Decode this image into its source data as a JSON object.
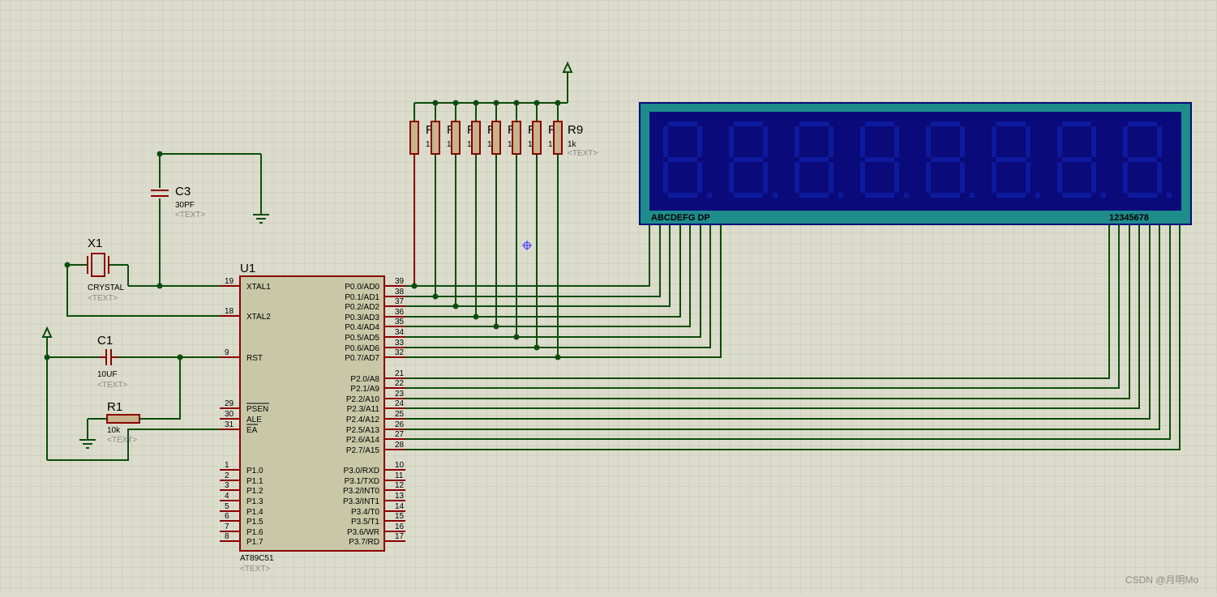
{
  "colors": {
    "background": "#dcdccc",
    "grid": "#c6c6b4",
    "wire": "#0b4d0b",
    "component": "#8b0000",
    "chip_body": "#c8c8a8",
    "display_frame": "#1f8c8c",
    "display_screen": "#0a0a7a",
    "segment_off": "#0d1a9e"
  },
  "mcu": {
    "ref": "U1",
    "part": "AT89C51",
    "text": "<TEXT>",
    "left_pins": [
      {
        "num": "19",
        "name": "XTAL1"
      },
      {
        "num": "18",
        "name": "XTAL2"
      },
      {
        "num": "9",
        "name": "RST"
      },
      {
        "num": "29",
        "name": "PSEN"
      },
      {
        "num": "30",
        "name": "ALE"
      },
      {
        "num": "31",
        "name": "EA"
      },
      {
        "num": "1",
        "name": "P1.0"
      },
      {
        "num": "2",
        "name": "P1.1"
      },
      {
        "num": "3",
        "name": "P1.2"
      },
      {
        "num": "4",
        "name": "P1.3"
      },
      {
        "num": "5",
        "name": "P1.4"
      },
      {
        "num": "6",
        "name": "P1.5"
      },
      {
        "num": "7",
        "name": "P1.6"
      },
      {
        "num": "8",
        "name": "P1.7"
      }
    ],
    "right_pins": [
      {
        "num": "39",
        "name": "P0.0/AD0"
      },
      {
        "num": "38",
        "name": "P0.1/AD1"
      },
      {
        "num": "37",
        "name": "P0.2/AD2"
      },
      {
        "num": "36",
        "name": "P0.3/AD3"
      },
      {
        "num": "35",
        "name": "P0.4/AD4"
      },
      {
        "num": "34",
        "name": "P0.5/AD5"
      },
      {
        "num": "33",
        "name": "P0.6/AD6"
      },
      {
        "num": "32",
        "name": "P0.7/AD7"
      },
      {
        "num": "21",
        "name": "P2.0/A8"
      },
      {
        "num": "22",
        "name": "P2.1/A9"
      },
      {
        "num": "23",
        "name": "P2.2/A10"
      },
      {
        "num": "24",
        "name": "P2.3/A11"
      },
      {
        "num": "25",
        "name": "P2.4/A12"
      },
      {
        "num": "26",
        "name": "P2.5/A13"
      },
      {
        "num": "27",
        "name": "P2.6/A14"
      },
      {
        "num": "28",
        "name": "P2.7/A15"
      },
      {
        "num": "10",
        "name": "P3.0/RXD"
      },
      {
        "num": "11",
        "name": "P3.1/TXD"
      },
      {
        "num": "12",
        "name": "P3.2/INT0"
      },
      {
        "num": "13",
        "name": "P3.3/INT1"
      },
      {
        "num": "14",
        "name": "P3.4/T0"
      },
      {
        "num": "15",
        "name": "P3.5/T1"
      },
      {
        "num": "16",
        "name": "P3.6/WR"
      },
      {
        "num": "17",
        "name": "P3.7/RD"
      }
    ]
  },
  "x1": {
    "ref": "X1",
    "value": "CRYSTAL",
    "text": "<TEXT>"
  },
  "c3": {
    "ref": "C3",
    "value": "30PF",
    "text": "<TEXT>"
  },
  "c1": {
    "ref": "C1",
    "value": "10UF",
    "text": "<TEXT>"
  },
  "r1": {
    "ref": "R1",
    "value": "10k",
    "text": "<TEXT>"
  },
  "pullups": {
    "ref": "R9",
    "value": "1k",
    "text": "<TEXT>",
    "count": 8
  },
  "display": {
    "segment_label": "ABCDEFG DP",
    "digit_label": "12345678",
    "digits": 8
  },
  "watermark": "CSDN @月明Mo"
}
